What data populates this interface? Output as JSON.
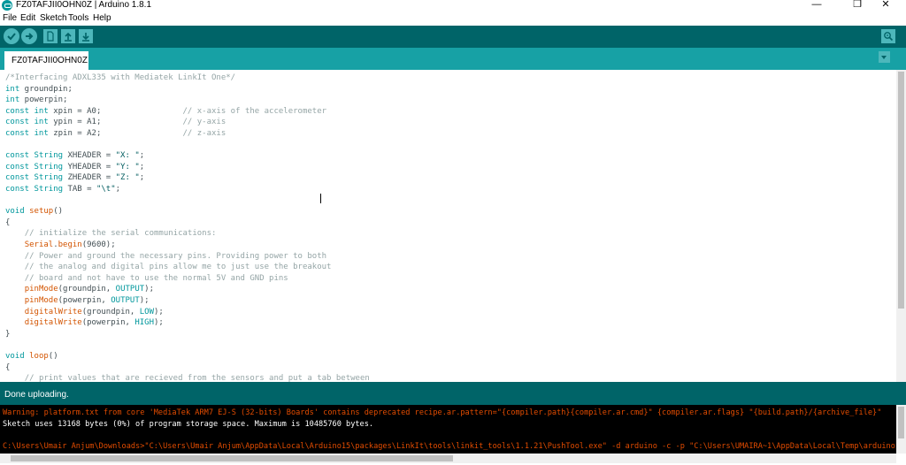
{
  "window": {
    "title": "FZ0TAFJII0OHN0Z | Arduino 1.8.1",
    "minimize_glyph": "—",
    "maximize_glyph": "❐",
    "close_glyph": "✕"
  },
  "menu": [
    "File",
    "Edit",
    "Sketch",
    "Tools",
    "Help"
  ],
  "toolbar": {
    "icons": [
      "verify-icon",
      "upload-icon",
      "new-sketch-icon",
      "open-sketch-icon",
      "save-sketch-icon",
      "serial-monitor-icon"
    ]
  },
  "tabs": [
    {
      "label": "FZ0TAFJII0OHN0Z"
    }
  ],
  "editor": {
    "lines": [
      [
        [
          "c",
          "/*Interfacing ADXL335 with Mediatek LinkIt One*/"
        ]
      ],
      [
        [
          "t",
          "int"
        ],
        [
          "p",
          " groundpin;"
        ]
      ],
      [
        [
          "t",
          "int"
        ],
        [
          "p",
          " powerpin;"
        ]
      ],
      [
        [
          "t",
          "const"
        ],
        [
          "p",
          " "
        ],
        [
          "t",
          "int"
        ],
        [
          "p",
          " xpin = A0;                 "
        ],
        [
          "c",
          "// x-axis of the accelerometer"
        ]
      ],
      [
        [
          "t",
          "const"
        ],
        [
          "p",
          " "
        ],
        [
          "t",
          "int"
        ],
        [
          "p",
          " ypin = A1;                 "
        ],
        [
          "c",
          "// y-axis"
        ]
      ],
      [
        [
          "t",
          "const"
        ],
        [
          "p",
          " "
        ],
        [
          "t",
          "int"
        ],
        [
          "p",
          " zpin = A2;                 "
        ],
        [
          "c",
          "// z-axis"
        ]
      ],
      [
        [
          "p",
          ""
        ]
      ],
      [
        [
          "t",
          "const"
        ],
        [
          "p",
          " "
        ],
        [
          "t",
          "String"
        ],
        [
          "p",
          " XHEADER = "
        ],
        [
          "s",
          "\"X: \""
        ],
        [
          "p",
          ";"
        ]
      ],
      [
        [
          "t",
          "const"
        ],
        [
          "p",
          " "
        ],
        [
          "t",
          "String"
        ],
        [
          "p",
          " YHEADER = "
        ],
        [
          "s",
          "\"Y: \""
        ],
        [
          "p",
          ";"
        ]
      ],
      [
        [
          "t",
          "const"
        ],
        [
          "p",
          " "
        ],
        [
          "t",
          "String"
        ],
        [
          "p",
          " ZHEADER = "
        ],
        [
          "s",
          "\"Z: \""
        ],
        [
          "p",
          ";"
        ]
      ],
      [
        [
          "t",
          "const"
        ],
        [
          "p",
          " "
        ],
        [
          "t",
          "String"
        ],
        [
          "p",
          " TAB = "
        ],
        [
          "s",
          "\"\\t\""
        ],
        [
          "p",
          ";"
        ]
      ],
      [
        [
          "p",
          ""
        ]
      ],
      [
        [
          "t",
          "void"
        ],
        [
          "p",
          " "
        ],
        [
          "f",
          "setup"
        ],
        [
          "p",
          "()"
        ]
      ],
      [
        [
          "p",
          "{"
        ]
      ],
      [
        [
          "p",
          "    "
        ],
        [
          "c",
          "// initialize the serial communications:"
        ]
      ],
      [
        [
          "p",
          "    "
        ],
        [
          "f",
          "Serial"
        ],
        [
          "p",
          "."
        ],
        [
          "f",
          "begin"
        ],
        [
          "p",
          "(9600);"
        ]
      ],
      [
        [
          "p",
          "    "
        ],
        [
          "c",
          "// Power and ground the necessary pins. Providing power to both"
        ]
      ],
      [
        [
          "p",
          "    "
        ],
        [
          "c",
          "// the analog and digital pins allow me to just use the breakout"
        ]
      ],
      [
        [
          "p",
          "    "
        ],
        [
          "c",
          "// board and not have to use the normal 5V and GND pins"
        ]
      ],
      [
        [
          "p",
          "    "
        ],
        [
          "f",
          "pinMode"
        ],
        [
          "p",
          "(groundpin, "
        ],
        [
          "k",
          "OUTPUT"
        ],
        [
          "p",
          ");"
        ]
      ],
      [
        [
          "p",
          "    "
        ],
        [
          "f",
          "pinMode"
        ],
        [
          "p",
          "(powerpin, "
        ],
        [
          "k",
          "OUTPUT"
        ],
        [
          "p",
          ");"
        ]
      ],
      [
        [
          "p",
          "    "
        ],
        [
          "f",
          "digitalWrite"
        ],
        [
          "p",
          "(groundpin, "
        ],
        [
          "k",
          "LOW"
        ],
        [
          "p",
          ");"
        ]
      ],
      [
        [
          "p",
          "    "
        ],
        [
          "f",
          "digitalWrite"
        ],
        [
          "p",
          "(powerpin, "
        ],
        [
          "k",
          "HIGH"
        ],
        [
          "p",
          ");"
        ]
      ],
      [
        [
          "p",
          "}"
        ]
      ],
      [
        [
          "p",
          ""
        ]
      ],
      [
        [
          "t",
          "void"
        ],
        [
          "p",
          " "
        ],
        [
          "f",
          "loop"
        ],
        [
          "p",
          "()"
        ]
      ],
      [
        [
          "p",
          "{"
        ]
      ],
      [
        [
          "p",
          "    "
        ],
        [
          "c",
          "// print values that are recieved from the sensors and put a tab between"
        ]
      ]
    ]
  },
  "status": {
    "message": "Done uploading."
  },
  "console": {
    "lines": [
      {
        "kind": "warn",
        "text": "Warning: platform.txt from core 'MediaTek ARM7 EJ-S (32-bits) Boards' contains deprecated recipe.ar.pattern=\"{compiler.path}{compiler.ar.cmd}\" {compiler.ar.flags} \"{build.path}/{archive_file}\""
      },
      {
        "kind": "ok",
        "text": "Sketch uses 13168 bytes (0%) of program storage space. Maximum is 10485760 bytes."
      },
      {
        "kind": "ok",
        "text": ""
      },
      {
        "kind": "warn",
        "text": "C:\\Users\\Umair Anjum\\Downloads>\"C:\\Users\\Umair Anjum\\AppData\\Local\\Arduino15\\packages\\LinkIt\\tools\\linkit_tools\\1.1.21\\PushTool.exe\" -d arduino -c -p \"C:\\Users\\UMAIRA~1\\AppData\\Local\\Temp\\arduino"
      }
    ]
  },
  "colors": {
    "toolbar": "#006468",
    "tabstrip": "#17a1a5",
    "button": "#4db7bb",
    "comment": "#95a5a6",
    "keyword": "#00979c",
    "function": "#d35400",
    "console_warning": "#e34c00"
  }
}
